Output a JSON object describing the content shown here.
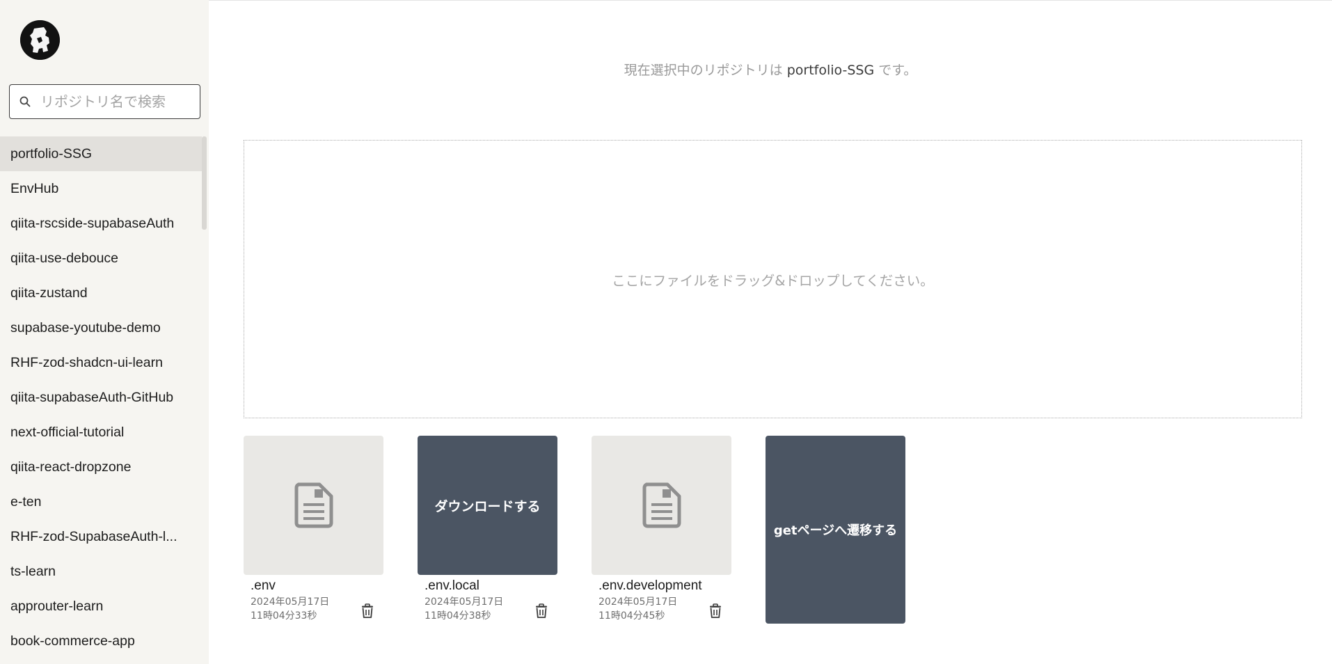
{
  "sidebar": {
    "search_placeholder": "リポジトリ名で検索",
    "repos": [
      "portfolio-SSG",
      "EnvHub",
      "qiita-rscside-supabaseAuth",
      "qiita-use-debouce",
      "qiita-zustand",
      "supabase-youtube-demo",
      "RHF-zod-shadcn-ui-learn",
      "qiita-supabaseAuth-GitHub",
      "next-official-tutorial",
      "qiita-react-dropzone",
      "e-ten",
      "RHF-zod-SupabaseAuth-l...",
      "ts-learn",
      "approuter-learn",
      "book-commerce-app"
    ]
  },
  "main": {
    "current_prefix": "現在選択中のリポジトリは",
    "current_repo": "portfolio-SSG",
    "current_suffix": "です。",
    "dropzone_text": "ここにファイルをドラッグ&ドロップしてください。",
    "files": [
      {
        "name": ".env",
        "date": "2024年05月17日",
        "time": "11時04分33秒"
      },
      {
        "name": ".env.local",
        "date": "2024年05月17日",
        "time": "11時04分38秒",
        "overlay": "ダウンロードする"
      },
      {
        "name": ".env.development",
        "date": "2024年05月17日",
        "time": "11時04分45秒"
      }
    ],
    "get_button": "getページへ遷移する"
  }
}
